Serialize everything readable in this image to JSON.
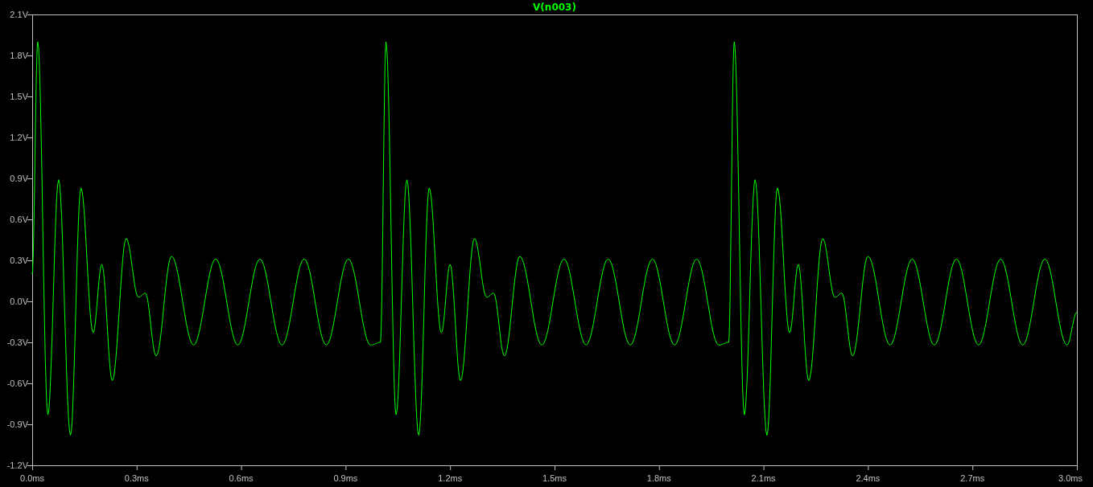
{
  "plot": {
    "title": "V(n003)",
    "y_ticks": [
      "2.1V",
      "1.8V",
      "1.5V",
      "1.2V",
      "0.9V",
      "0.6V",
      "0.3V",
      "0.0V",
      "-0.3V",
      "-0.6V",
      "-0.9V",
      "-1.2V"
    ],
    "x_ticks": [
      "0.0ms",
      "0.3ms",
      "0.6ms",
      "0.9ms",
      "1.2ms",
      "1.5ms",
      "1.8ms",
      "2.1ms",
      "2.4ms",
      "2.7ms",
      "3.0ms"
    ]
  }
}
